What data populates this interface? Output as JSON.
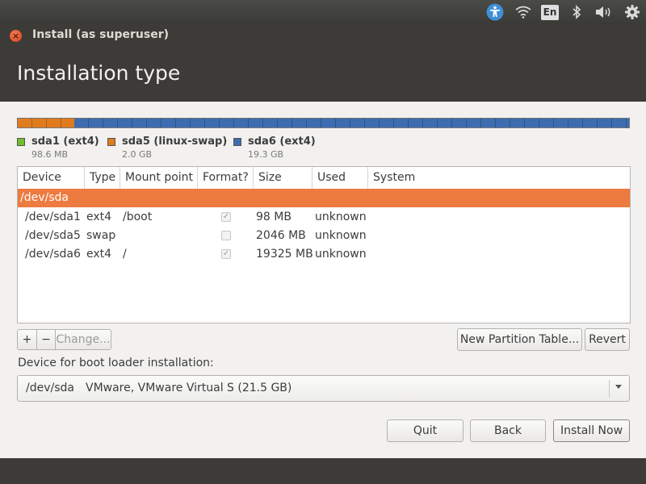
{
  "window": {
    "title": "Install (as superuser)",
    "page_title": "Installation type"
  },
  "panel": {
    "keyboard_indicator": "En"
  },
  "partition_bar": {
    "colors": {
      "sda1": "#6fbf2a",
      "sda5": "#e07c1e",
      "sda6": "#3d6db0"
    },
    "segments": [
      {
        "name": "sda5",
        "fraction": 0.093
      },
      {
        "name": "sda6",
        "fraction": 0.907
      }
    ]
  },
  "legend": [
    {
      "name": "sda1 (ext4)",
      "size": "98.6 MB",
      "color": "#6fbf2a"
    },
    {
      "name": "sda5 (linux-swap)",
      "size": "2.0 GB",
      "color": "#e07c1e"
    },
    {
      "name": "sda6 (ext4)",
      "size": "19.3 GB",
      "color": "#3d6db0"
    }
  ],
  "table": {
    "headers": [
      "Device",
      "Type",
      "Mount point",
      "Format?",
      "Size",
      "Used",
      "System"
    ],
    "selected_row": {
      "device": "/dev/sda"
    },
    "rows": [
      {
        "device": "/dev/sda1",
        "type": "ext4",
        "mount": "/boot",
        "format": true,
        "size": "98 MB",
        "used": "unknown"
      },
      {
        "device": "/dev/sda5",
        "type": "swap",
        "mount": "",
        "format": false,
        "size": "2046 MB",
        "used": "unknown"
      },
      {
        "device": "/dev/sda6",
        "type": "ext4",
        "mount": "/",
        "format": true,
        "size": "19325 MB",
        "used": "unknown"
      }
    ]
  },
  "toolbar": {
    "add_label": "+",
    "remove_label": "−",
    "change_label": "Change...",
    "new_table_label": "New Partition Table...",
    "revert_label": "Revert"
  },
  "bootloader": {
    "label": "Device for boot loader installation:",
    "device": "/dev/sda",
    "description": "VMware, VMware Virtual S (21.5 GB)"
  },
  "actions": {
    "quit_label": "Quit",
    "back_label": "Back",
    "install_label": "Install Now"
  },
  "colors": {
    "selection": "#ed7a3f",
    "close_button": "#e5562d"
  }
}
